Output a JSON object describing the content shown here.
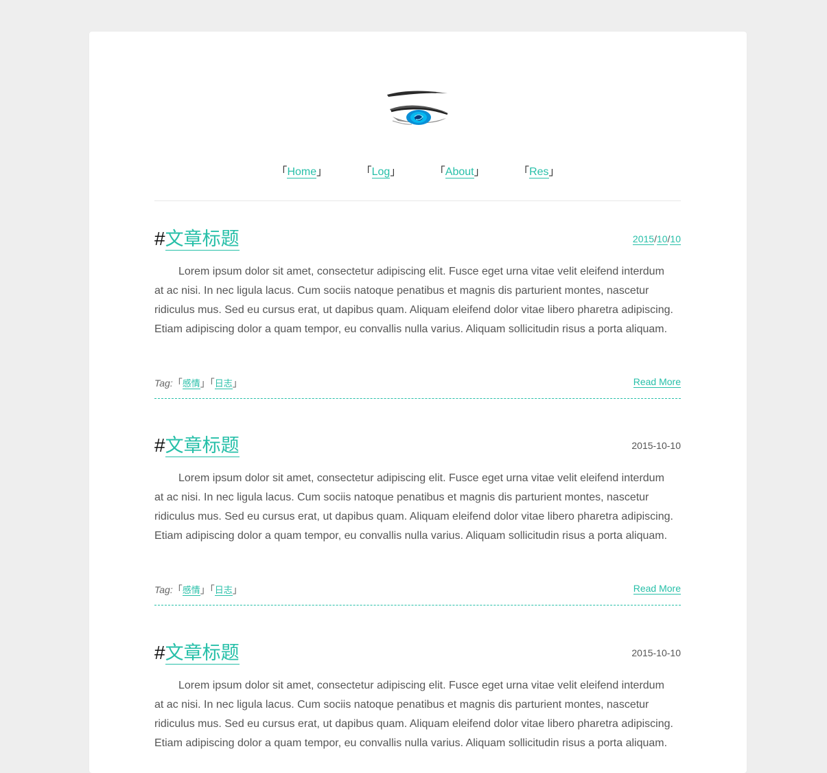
{
  "accent_color": "#26bfa8",
  "logo": {
    "icon": "anime-eye-logo"
  },
  "nav": {
    "open_bracket": "「",
    "close_bracket": "」",
    "items": [
      {
        "label": "Home"
      },
      {
        "label": "Log"
      },
      {
        "label": "About"
      },
      {
        "label": "Res"
      }
    ]
  },
  "posts": [
    {
      "hash": "#",
      "title": "文章标题",
      "date_parts": [
        "2015",
        "10",
        "10"
      ],
      "date_separator": "/",
      "body": "Lorem ipsum dolor sit amet, consectetur adipiscing elit. Fusce eget urna vitae velit eleifend interdum at ac nisi. In nec ligula lacus. Cum sociis natoque penatibus et magnis dis parturient montes, nascetur ridiculus mus. Sed eu cursus erat, ut dapibus quam. Aliquam eleifend dolor vitae libero pharetra adipiscing. Etiam adipiscing dolor a quam tempor, eu convallis nulla varius. Aliquam sollicitudin risus a porta aliquam.",
      "tag_label": "Tag:",
      "tags": [
        "感情",
        "日志"
      ],
      "read_more": "Read More"
    },
    {
      "hash": "#",
      "title": "文章标题",
      "date": "2015-10-10",
      "body": "Lorem ipsum dolor sit amet, consectetur adipiscing elit. Fusce eget urna vitae velit eleifend interdum at ac nisi. In nec ligula lacus. Cum sociis natoque penatibus et magnis dis parturient montes, nascetur ridiculus mus. Sed eu cursus erat, ut dapibus quam. Aliquam eleifend dolor vitae libero pharetra adipiscing. Etiam adipiscing dolor a quam tempor, eu convallis nulla varius. Aliquam sollicitudin risus a porta aliquam.",
      "tag_label": "Tag:",
      "tags": [
        "感情",
        "日志"
      ],
      "read_more": "Read More"
    },
    {
      "hash": "#",
      "title": "文章标题",
      "date": "2015-10-10",
      "body": "Lorem ipsum dolor sit amet, consectetur adipiscing elit. Fusce eget urna vitae velit eleifend interdum at ac nisi. In nec ligula lacus. Cum sociis natoque penatibus et magnis dis parturient montes, nascetur ridiculus mus. Sed eu cursus erat, ut dapibus quam. Aliquam eleifend dolor vitae libero pharetra adipiscing. Etiam adipiscing dolor a quam tempor, eu convallis nulla varius. Aliquam sollicitudin risus a porta aliquam."
    }
  ]
}
